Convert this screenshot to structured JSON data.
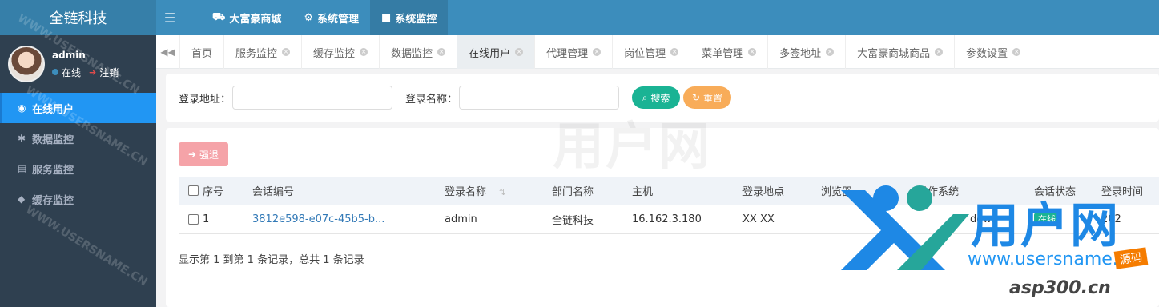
{
  "app": {
    "brand": "全链科技"
  },
  "user": {
    "name": "admin",
    "status": "在线",
    "logout": "注销"
  },
  "sidebar": {
    "items": [
      {
        "label": "在线用户",
        "icon": "user-circle-icon",
        "active": true
      },
      {
        "label": "数据监控",
        "icon": "bug-icon",
        "active": false
      },
      {
        "label": "服务监控",
        "icon": "server-icon",
        "active": false
      },
      {
        "label": "缓存监控",
        "icon": "cube-icon",
        "active": false
      }
    ]
  },
  "topnav": {
    "items": [
      {
        "label": "大富豪商城",
        "icon": "truck-icon"
      },
      {
        "label": "系统管理",
        "icon": "gear-icon"
      },
      {
        "label": "系统监控",
        "icon": "video-icon",
        "active": true
      }
    ]
  },
  "tabs": [
    {
      "label": "首页",
      "closable": false
    },
    {
      "label": "服务监控",
      "closable": true
    },
    {
      "label": "缓存监控",
      "closable": true
    },
    {
      "label": "数据监控",
      "closable": true
    },
    {
      "label": "在线用户",
      "closable": true,
      "active": true
    },
    {
      "label": "代理管理",
      "closable": true
    },
    {
      "label": "岗位管理",
      "closable": true
    },
    {
      "label": "菜单管理",
      "closable": true
    },
    {
      "label": "多签地址",
      "closable": true
    },
    {
      "label": "大富豪商城商品",
      "closable": true
    },
    {
      "label": "参数设置",
      "closable": true
    }
  ],
  "search": {
    "login_address_label": "登录地址：",
    "login_address_value": "",
    "login_name_label": "登录名称：",
    "login_name_value": "",
    "search_button": "搜索",
    "reset_button": "重置"
  },
  "toolbar": {
    "kick_button": "强退"
  },
  "table": {
    "columns": [
      "序号",
      "会话编号",
      "登录名称",
      "部门名称",
      "主机",
      "登录地点",
      "浏览器",
      "操作系统",
      "会话状态",
      "登录时间"
    ],
    "rows": [
      {
        "index": "1",
        "session_id": "3812e598-e07c-45b5-b...",
        "login_name": "admin",
        "dept": "全链科技",
        "host": "16.162.3.180",
        "location": "XX XX",
        "browser": "",
        "os": "dows",
        "status": "在线",
        "login_time": "202"
      }
    ]
  },
  "pager": {
    "info": "显示第 1 到第 1 条记录，总共 1 条记录"
  },
  "overlay": {
    "watermark_center": "用户网",
    "logo_text": "用户网",
    "logo_url1": "www.usersname.cn",
    "logo_tag": "源码",
    "logo_url2": "asp300.cn",
    "diag_watermark": "WWW.USERSNAME.CN"
  },
  "colors": {
    "sidebar_bg": "#2f4050",
    "header_bg": "#3c8dbc",
    "active_menu": "#2196f3",
    "search_btn": "#1ab394",
    "reset_btn": "#f8ac59",
    "kick_btn": "#f5a3a8",
    "logo_blue": "#1e88e5",
    "logo_teal": "#26a69a"
  }
}
